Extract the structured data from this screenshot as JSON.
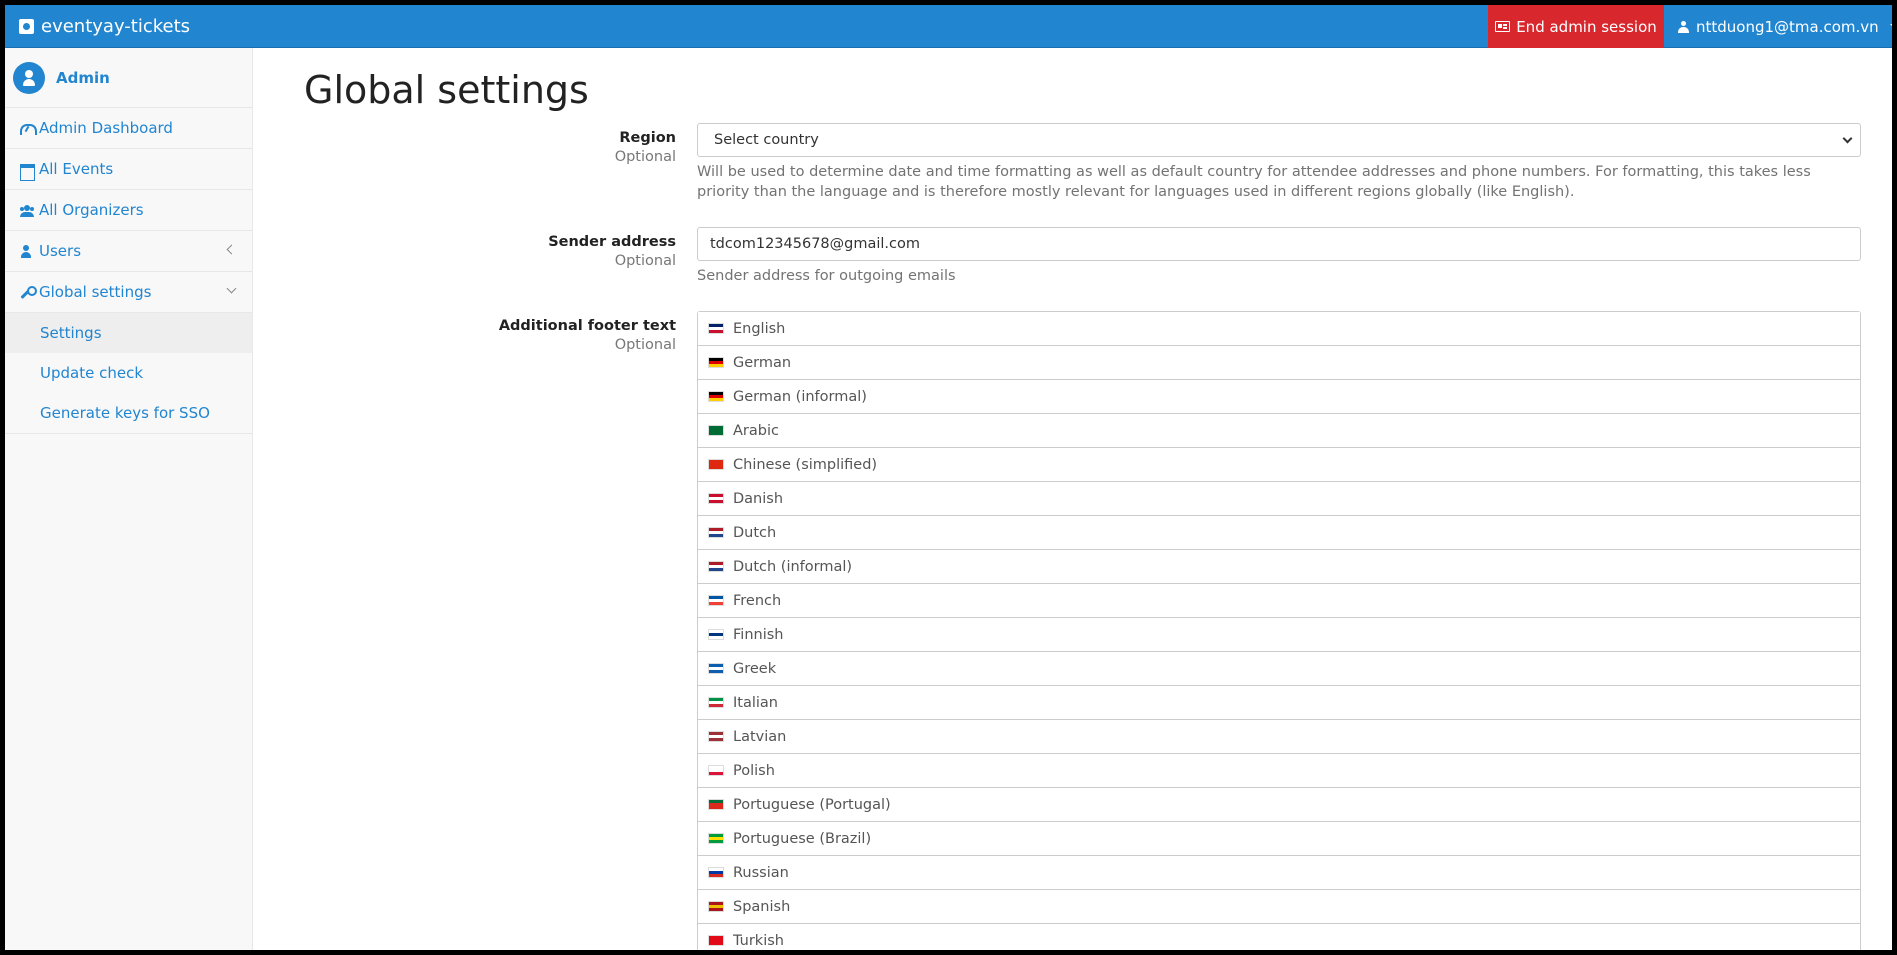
{
  "topnav": {
    "brand": "eventyay-tickets",
    "end_session": "End admin session",
    "user_email": "nttduong1@tma.com.vn"
  },
  "sidebar": {
    "admin_name": "Admin",
    "items": [
      {
        "label": "Admin Dashboard",
        "icon": "dashboard-icon"
      },
      {
        "label": "All Events",
        "icon": "calendar-icon"
      },
      {
        "label": "All Organizers",
        "icon": "users-icon"
      },
      {
        "label": "Users",
        "icon": "user-icon"
      },
      {
        "label": "Global settings",
        "icon": "wrench-icon"
      }
    ],
    "sub_items": [
      {
        "label": "Settings",
        "active": true
      },
      {
        "label": "Update check",
        "active": false
      },
      {
        "label": "Generate keys for SSO",
        "active": false
      }
    ]
  },
  "main": {
    "title": "Global settings",
    "region": {
      "label": "Region",
      "optional": "Optional",
      "value": "Select country",
      "help": "Will be used to determine date and time formatting as well as default country for attendee addresses and phone numbers. For formatting, this takes less priority than the language and is therefore mostly relevant for languages used in different regions globally (like English)."
    },
    "sender": {
      "label": "Sender address",
      "optional": "Optional",
      "value": "tdcom12345678@gmail.com",
      "help": "Sender address for outgoing emails"
    },
    "footer": {
      "label": "Additional footer text",
      "optional": "Optional",
      "languages": [
        {
          "name": "English",
          "flag": [
            "#012169",
            "#ffffff",
            "#c8102e"
          ]
        },
        {
          "name": "German",
          "flag": [
            "#000000",
            "#dd0000",
            "#ffce00"
          ]
        },
        {
          "name": "German (informal)",
          "flag": [
            "#000000",
            "#dd0000",
            "#ffce00"
          ]
        },
        {
          "name": "Arabic",
          "flag": [
            "#006c35",
            "#006c35",
            "#006c35"
          ]
        },
        {
          "name": "Chinese (simplified)",
          "flag": [
            "#de2910",
            "#de2910",
            "#de2910"
          ]
        },
        {
          "name": "Danish",
          "flag": [
            "#c8102e",
            "#ffffff",
            "#c8102e"
          ]
        },
        {
          "name": "Dutch",
          "flag": [
            "#ae1c28",
            "#ffffff",
            "#21468b"
          ]
        },
        {
          "name": "Dutch (informal)",
          "flag": [
            "#ae1c28",
            "#ffffff",
            "#21468b"
          ]
        },
        {
          "name": "French",
          "flag": [
            "#0055a4",
            "#ffffff",
            "#ef4135"
          ]
        },
        {
          "name": "Finnish",
          "flag": [
            "#ffffff",
            "#003580",
            "#ffffff"
          ]
        },
        {
          "name": "Greek",
          "flag": [
            "#0d5eaf",
            "#ffffff",
            "#0d5eaf"
          ]
        },
        {
          "name": "Italian",
          "flag": [
            "#009246",
            "#ffffff",
            "#ce2b37"
          ]
        },
        {
          "name": "Latvian",
          "flag": [
            "#9e3039",
            "#ffffff",
            "#9e3039"
          ]
        },
        {
          "name": "Polish",
          "flag": [
            "#ffffff",
            "#ffffff",
            "#dc143c"
          ]
        },
        {
          "name": "Portuguese (Portugal)",
          "flag": [
            "#046a38",
            "#da291c",
            "#da291c"
          ]
        },
        {
          "name": "Portuguese (Brazil)",
          "flag": [
            "#009c3b",
            "#ffdf00",
            "#009c3b"
          ]
        },
        {
          "name": "Russian",
          "flag": [
            "#ffffff",
            "#0039a6",
            "#d52b1e"
          ]
        },
        {
          "name": "Spanish",
          "flag": [
            "#aa151b",
            "#f1bf00",
            "#aa151b"
          ]
        },
        {
          "name": "Turkish",
          "flag": [
            "#e30a17",
            "#e30a17",
            "#e30a17"
          ]
        }
      ]
    }
  }
}
